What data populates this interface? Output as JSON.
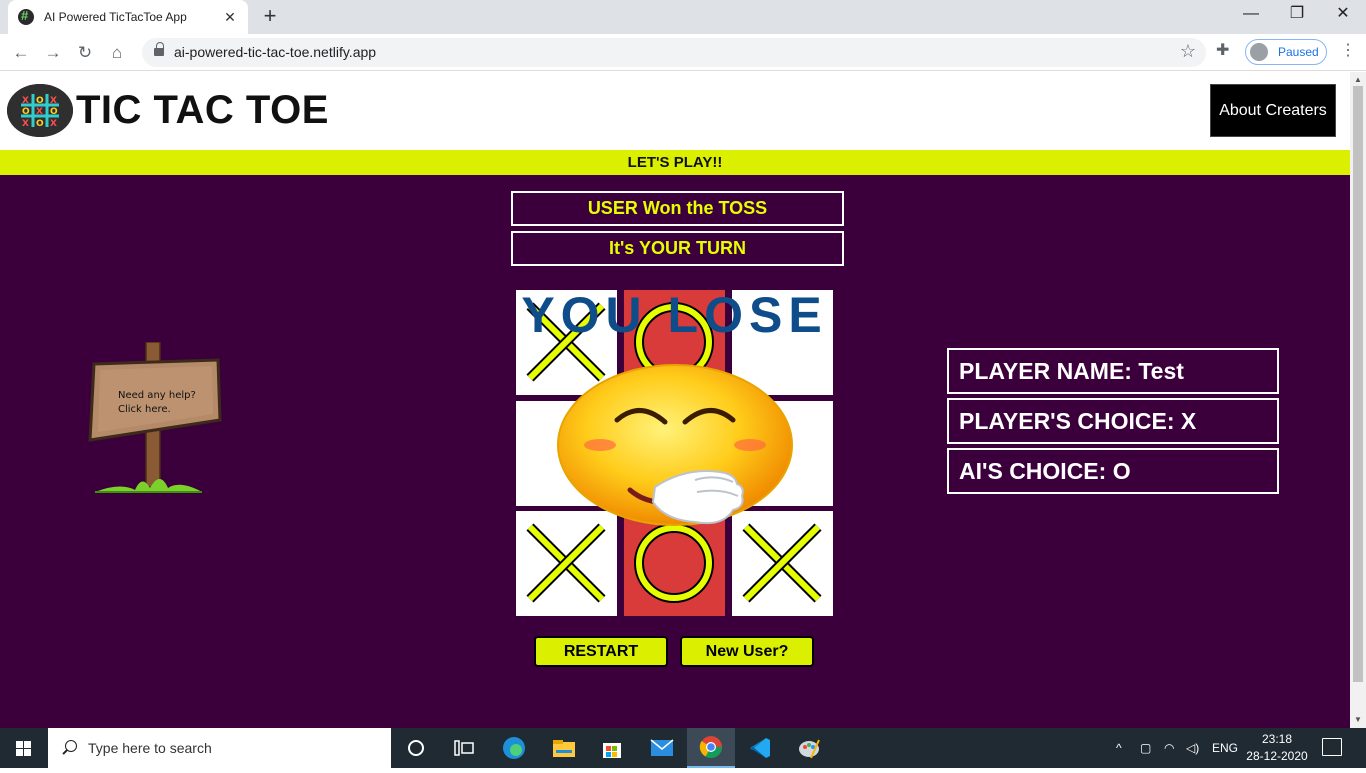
{
  "browser": {
    "tab_title": "AI Powered TicTacToe App",
    "tab_close": "✕",
    "new_tab": "+",
    "url": "ai-powered-tic-tac-toe.netlify.app",
    "profile_status": "Paused",
    "window_controls": {
      "minimize": "—",
      "restore": "❐",
      "close": "✕"
    }
  },
  "header": {
    "title": "TIC TAC TOE",
    "about_button": "About Creaters"
  },
  "banner": {
    "text": "LET'S PLAY!!"
  },
  "status": {
    "toss": "USER Won the TOSS",
    "turn": "It's YOUR TURN"
  },
  "board": {
    "cells": [
      "X",
      "O",
      "",
      "",
      "",
      "",
      "X",
      "O",
      "X"
    ],
    "winning_cells": [
      1,
      4,
      7
    ],
    "result_text": "YOU LOSE",
    "x_color": "#e6ff00",
    "o_color": "#e6ff00"
  },
  "help_sign": {
    "line1": "Need any help?",
    "line2": "Click here."
  },
  "player_info": {
    "name": "PLAYER NAME: Test",
    "choice": "PLAYER'S CHOICE: X",
    "ai_choice": "AI'S CHOICE: O"
  },
  "buttons": {
    "restart": "RESTART",
    "new_user": "New User?"
  },
  "taskbar": {
    "search_placeholder": "Type here to search",
    "language": "ENG",
    "time": "23:18",
    "date": "28-12-2020"
  },
  "colors": {
    "page_bg": "#3b003b",
    "accent": "#dbf000",
    "win_cell": "#d93a3a"
  }
}
